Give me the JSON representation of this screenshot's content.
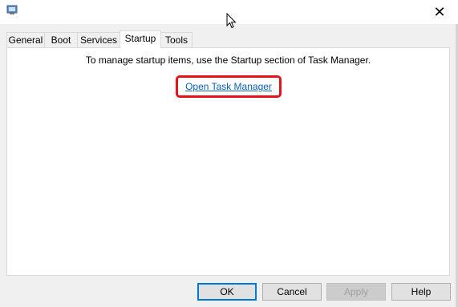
{
  "window": {
    "icon": "msconfig-icon",
    "close_glyph": "✕"
  },
  "tabs": [
    {
      "label": "General"
    },
    {
      "label": "Boot"
    },
    {
      "label": "Services"
    },
    {
      "label": "Startup",
      "selected": true
    },
    {
      "label": "Tools"
    }
  ],
  "startup": {
    "info_text": "To manage startup items, use the Startup section of Task Manager.",
    "link_label": "Open Task Manager",
    "highlight_color": "#e8121b",
    "link_color": "#0b5fb3"
  },
  "buttons": {
    "ok": "OK",
    "cancel": "Cancel",
    "apply": "Apply",
    "help": "Help"
  }
}
